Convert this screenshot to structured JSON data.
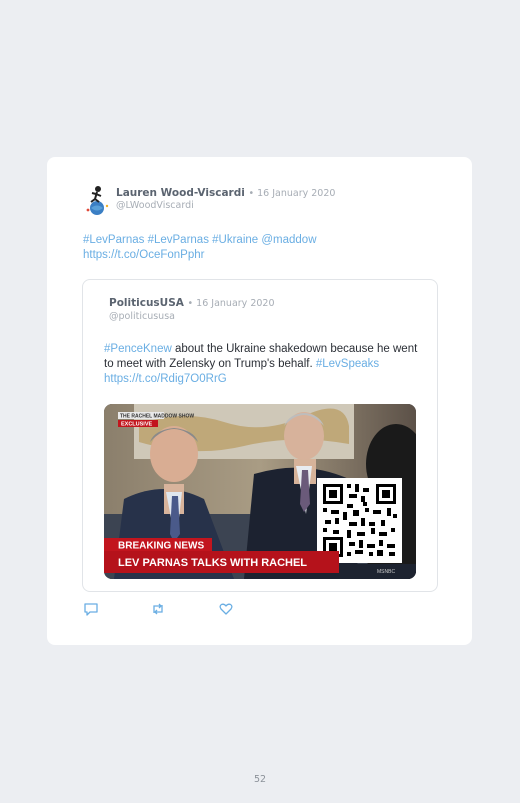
{
  "tweet": {
    "author_name": "Lauren Wood-Viscardi",
    "date": "16 January 2020",
    "handle": "@LWoodViscardi",
    "text_line1": "#LevParnas #LevParnas #Ukraine @maddow",
    "text_line2": "https://t.co/OceFonPphr"
  },
  "quoted": {
    "author_name": "PoliticusUSA",
    "date": "16 January 2020",
    "handle": "@politicususa",
    "hashtag1": "#PenceKnew",
    "text_part1": " about the Ukraine shakedown because he went to meet with Zelensky on Trump's behalf. ",
    "hashtag2": "#LevSpeaks",
    "link": " https://t.co/Rdig7O0RrG",
    "media": {
      "show_name": "THE RACHEL MADDOW SHOW",
      "exclusive_tag": "EXCLUSIVE",
      "breaking_label": "BREAKING NEWS",
      "headline": "LEV PARNAS TALKS WITH RACHEL",
      "network_bug": "MSNBC"
    }
  },
  "actions": {
    "reply_icon": "reply-icon",
    "retweet_icon": "retweet-icon",
    "like_icon": "heart-icon"
  },
  "footer": {
    "page_number": "52"
  },
  "colors": {
    "link": "#6aaee3",
    "page_bg": "#eceef2",
    "breaking_red": "#c2151e"
  }
}
